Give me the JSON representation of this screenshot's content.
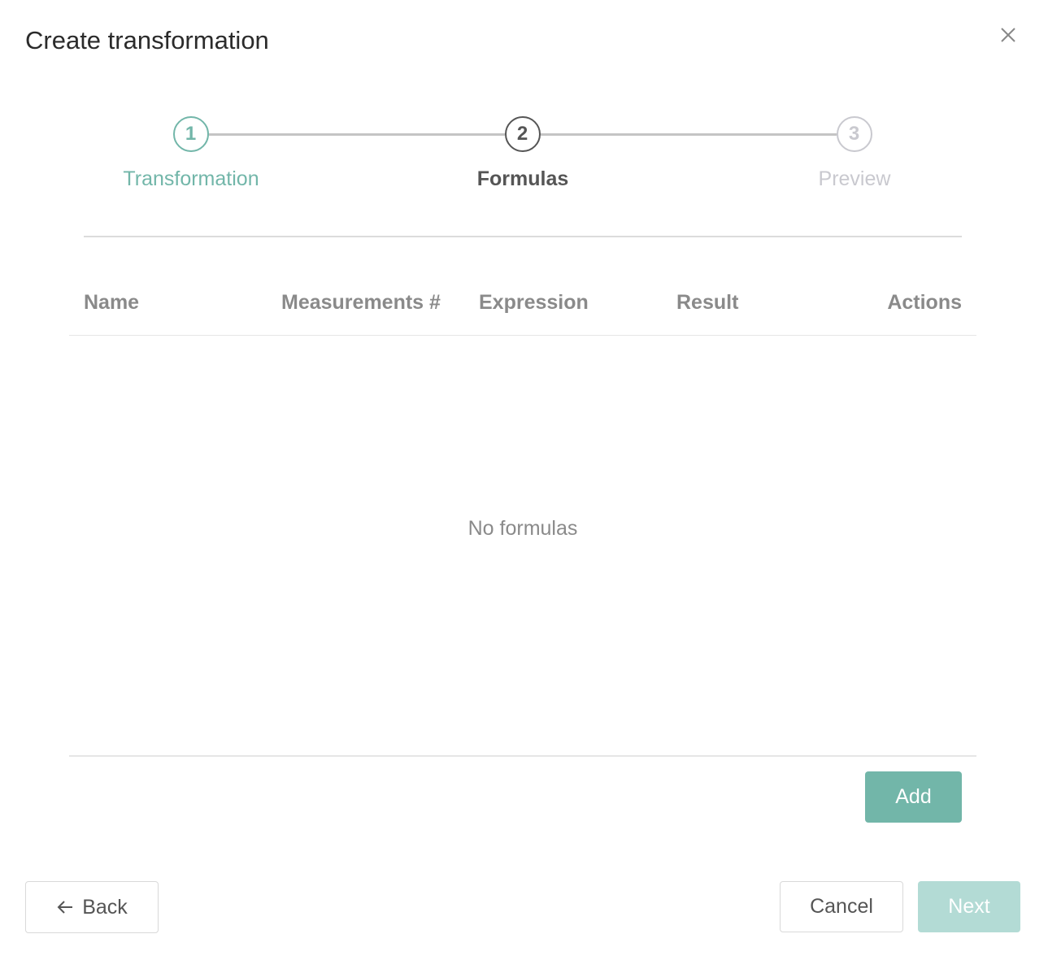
{
  "dialog": {
    "title": "Create transformation",
    "close_icon": "close-icon"
  },
  "stepper": {
    "steps": [
      {
        "number": "1",
        "label": "Transformation",
        "state": "done"
      },
      {
        "number": "2",
        "label": "Formulas",
        "state": "active"
      },
      {
        "number": "3",
        "label": "Preview",
        "state": "todo"
      }
    ]
  },
  "table": {
    "columns": [
      "Name",
      "Measurements #",
      "Expression",
      "Result",
      "Actions"
    ],
    "rows": [],
    "empty_text": "No formulas"
  },
  "actions": {
    "add_label": "Add",
    "back_label": "Back",
    "cancel_label": "Cancel",
    "next_label": "Next",
    "next_enabled": false
  },
  "colors": {
    "accent": "#72b6a9",
    "accent_disabled": "#b3dbd5",
    "active_step": "#555555",
    "inactive_step": "#c9c9cf",
    "muted_text": "#8a8a8a"
  }
}
